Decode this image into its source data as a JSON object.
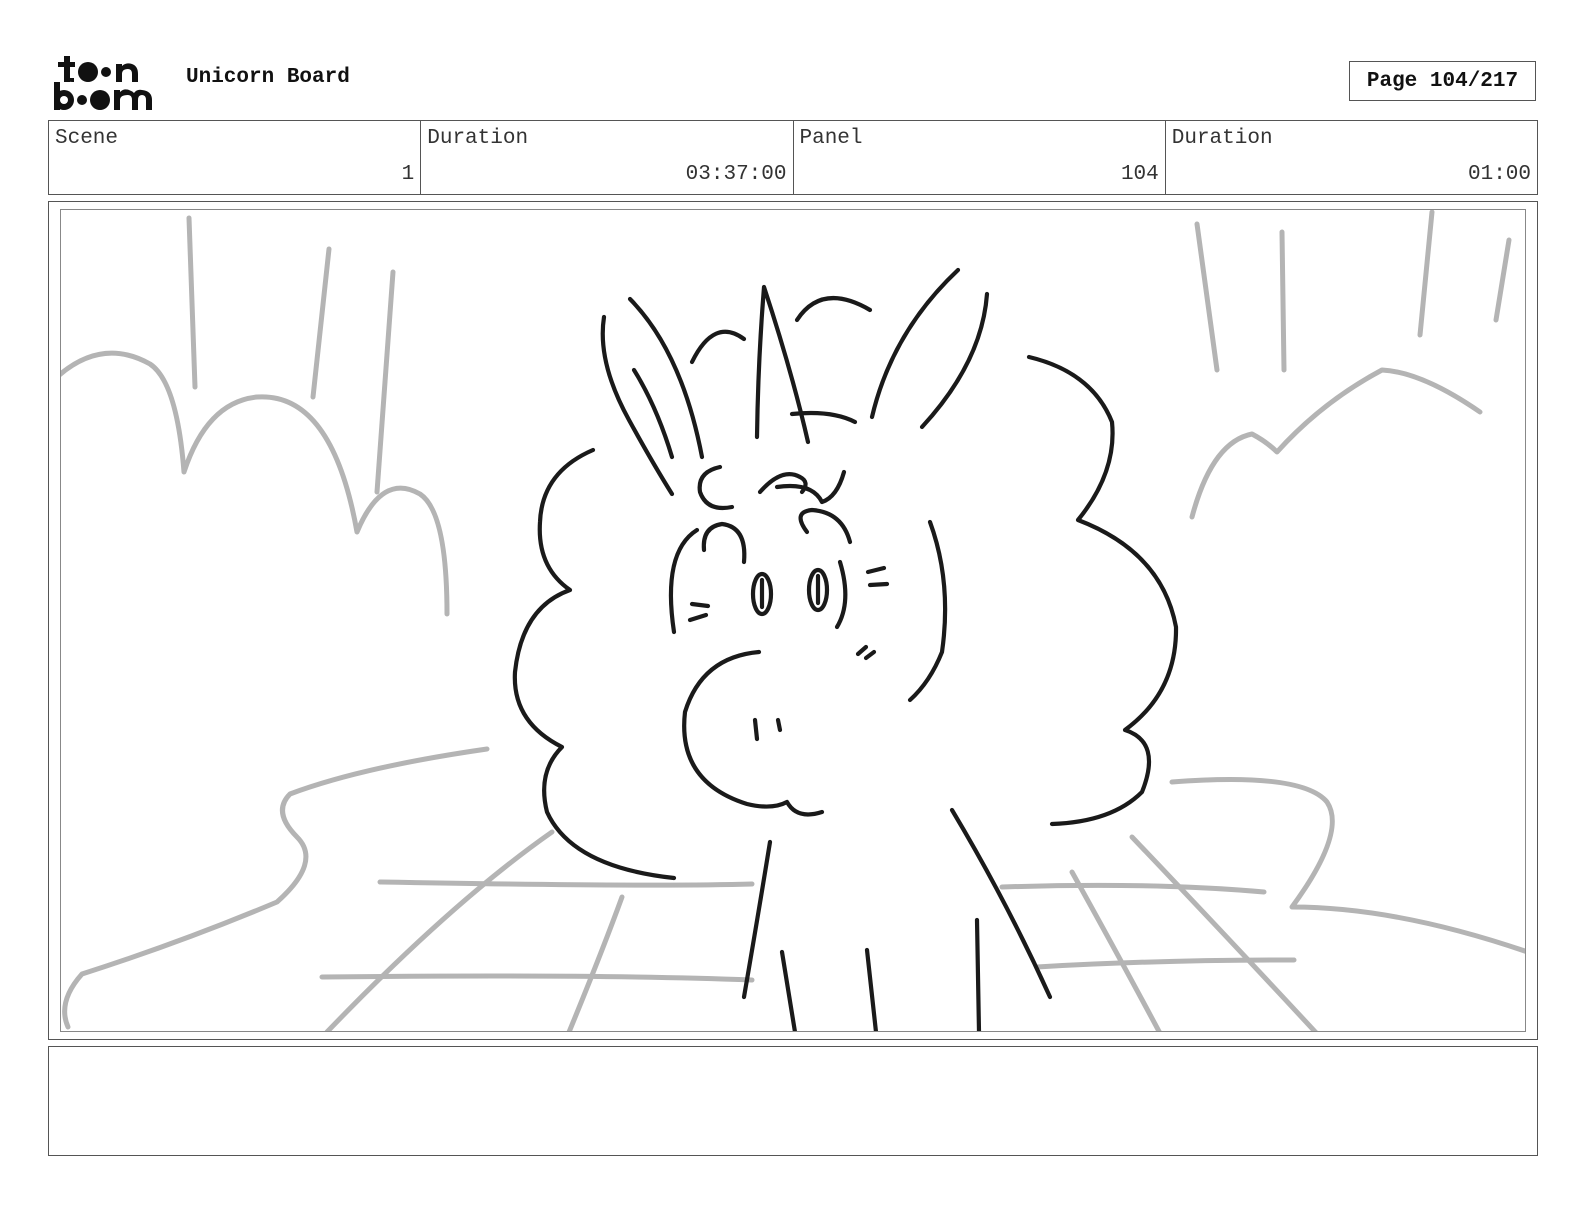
{
  "header": {
    "logo_icon": "toonboom-logo-icon",
    "board_title": "Unicorn Board",
    "page_label": "Page 104/217"
  },
  "info": {
    "scene_label": "Scene",
    "scene_value": "1",
    "scene_duration_label": "Duration",
    "scene_duration_value": "03:37:00",
    "panel_label": "Panel",
    "panel_value": "104",
    "panel_duration_label": "Duration",
    "panel_duration_value": "01:00"
  },
  "panel": {
    "image_icon": "unicorn-sketch-image",
    "line_color": "#1a1a1a",
    "background_sketch_color": "#b4b4b4"
  },
  "notes": {
    "text": ""
  }
}
